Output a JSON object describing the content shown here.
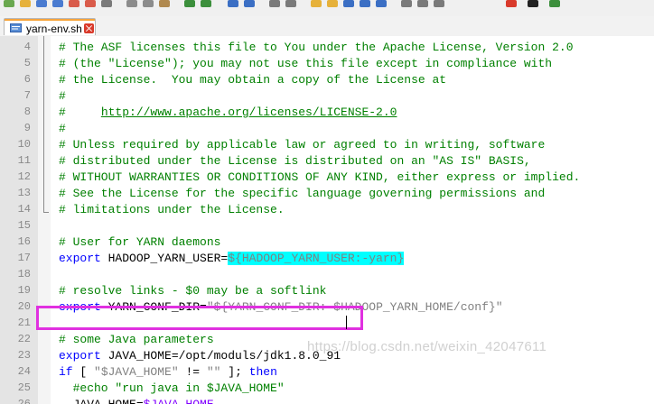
{
  "toolbar": {
    "icons": [
      "new-file-icon",
      "open-folder-icon",
      "save-icon",
      "save-all-icon",
      "close-icon",
      "close-all-icon",
      "print-icon",
      "cut-icon",
      "copy-icon",
      "paste-icon",
      "undo-icon",
      "redo-icon",
      "find-icon",
      "replace-icon",
      "zoom-in-icon",
      "zoom-out-icon",
      "sync-vertical-icon",
      "sync-horizontal-icon",
      "word-wrap-icon",
      "all-chars-icon",
      "indent-guide-icon",
      "user-lang-icon",
      "doc-map-icon",
      "function-list-icon",
      "record-macro-icon",
      "stop-macro-icon",
      "play-macro-icon"
    ]
  },
  "tab": {
    "label": "yarn-env.sh"
  },
  "editor": {
    "lines": [
      {
        "num": "4",
        "tokens": [
          {
            "t": "# The ASF licenses this file to You under the Apache License, Version 2.0",
            "c": "c-comment"
          }
        ]
      },
      {
        "num": "5",
        "tokens": [
          {
            "t": "# (the \"License\"); you may not use this file except in compliance with",
            "c": "c-comment"
          }
        ]
      },
      {
        "num": "6",
        "tokens": [
          {
            "t": "# the License.  You may obtain a copy of the License at",
            "c": "c-comment"
          }
        ]
      },
      {
        "num": "7",
        "tokens": [
          {
            "t": "#",
            "c": "c-comment"
          }
        ]
      },
      {
        "num": "8",
        "tokens": [
          {
            "t": "#     ",
            "c": "c-comment"
          },
          {
            "t": "http://www.apache.org/licenses/LICENSE-2.0",
            "c": "c-comment c-link"
          }
        ]
      },
      {
        "num": "9",
        "tokens": [
          {
            "t": "#",
            "c": "c-comment"
          }
        ]
      },
      {
        "num": "10",
        "tokens": [
          {
            "t": "# Unless required by applicable law or agreed to in writing, software",
            "c": "c-comment"
          }
        ]
      },
      {
        "num": "11",
        "tokens": [
          {
            "t": "# distributed under the License is distributed on an \"AS IS\" BASIS,",
            "c": "c-comment"
          }
        ]
      },
      {
        "num": "12",
        "tokens": [
          {
            "t": "# WITHOUT WARRANTIES OR CONDITIONS OF ANY KIND, either express or implied.",
            "c": "c-comment"
          }
        ]
      },
      {
        "num": "13",
        "tokens": [
          {
            "t": "# See the License for the specific language governing permissions and",
            "c": "c-comment"
          }
        ]
      },
      {
        "num": "14",
        "tokens": [
          {
            "t": "# limitations under the License.",
            "c": "c-comment"
          }
        ]
      },
      {
        "num": "15",
        "tokens": []
      },
      {
        "num": "16",
        "tokens": [
          {
            "t": "# User for YARN daemons",
            "c": "c-comment"
          }
        ]
      },
      {
        "num": "17",
        "tokens": [
          {
            "t": "export",
            "c": "c-keyword"
          },
          {
            "t": " HADOOP_YARN_USER=",
            "c": "c-plain"
          },
          {
            "t": "${HADOOP_YARN_USER:-yarn}",
            "c": "c-highlight"
          }
        ]
      },
      {
        "num": "18",
        "tokens": []
      },
      {
        "num": "19",
        "tokens": [
          {
            "t": "# resolve links - $0 may be a softlink",
            "c": "c-comment"
          }
        ]
      },
      {
        "num": "20",
        "tokens": [
          {
            "t": "export",
            "c": "c-keyword"
          },
          {
            "t": " YARN_CONF_DIR=",
            "c": "c-plain"
          },
          {
            "t": "\"${YARN_CONF_DIR:-$HADOOP_YARN_HOME/conf}\"",
            "c": "c-string"
          }
        ]
      },
      {
        "num": "21",
        "tokens": []
      },
      {
        "num": "22",
        "tokens": [
          {
            "t": "# some Java parameters",
            "c": "c-comment"
          }
        ]
      },
      {
        "num": "23",
        "tokens": [
          {
            "t": "export",
            "c": "c-keyword"
          },
          {
            "t": " JAVA_HOME=/opt/moduls/jdk1.8.0_91",
            "c": "c-plain"
          }
        ]
      },
      {
        "num": "24",
        "tokens": [
          {
            "t": "if",
            "c": "c-keyword"
          },
          {
            "t": " [ ",
            "c": "c-plain"
          },
          {
            "t": "\"$JAVA_HOME\"",
            "c": "c-string"
          },
          {
            "t": " != ",
            "c": "c-plain"
          },
          {
            "t": "\"\"",
            "c": "c-string"
          },
          {
            "t": " ]; ",
            "c": "c-plain"
          },
          {
            "t": "then",
            "c": "c-keyword"
          }
        ]
      },
      {
        "num": "25",
        "tokens": [
          {
            "t": "  #echo \"run java in $JAVA_HOME\"",
            "c": "c-comment"
          }
        ]
      },
      {
        "num": "26",
        "tokens": [
          {
            "t": "  JAVA_HOME=",
            "c": "c-plain"
          },
          {
            "t": "$JAVA_HOME",
            "c": "c-purple"
          }
        ]
      }
    ]
  },
  "watermark": {
    "text": "https://blog.csdn.net/weixin_42047611"
  },
  "colors": {
    "comment": "#008000",
    "keyword": "#0000ff",
    "highlight_bg": "#00ffff",
    "box_border": "#e030e0",
    "gutter_bg": "#e4e4e4"
  }
}
